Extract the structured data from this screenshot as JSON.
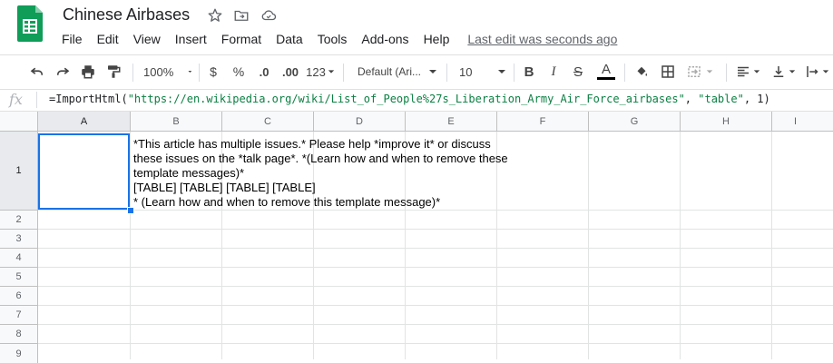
{
  "app": {
    "doc_title": "Chinese Airbases",
    "colors": {
      "logo_green": "#0f9d58",
      "selection_blue": "#1a73e8",
      "string_green": "#0b8043"
    }
  },
  "menu": {
    "items": [
      "File",
      "Edit",
      "View",
      "Insert",
      "Format",
      "Data",
      "Tools",
      "Add-ons",
      "Help"
    ],
    "last_edit": "Last edit was seconds ago"
  },
  "toolbar": {
    "zoom": "100%",
    "currency": "$",
    "percent": "%",
    "decrease_decimal": ".0",
    "increase_decimal": ".00",
    "more_formats": "123",
    "font": "Default (Ari...",
    "font_size": "10",
    "bold": "B",
    "italic": "I",
    "strikethrough": "S",
    "text_color": "A"
  },
  "formula_bar": {
    "fx": "fx",
    "func": "=ImportHtml(",
    "url": "\"https://en.wikipedia.org/wiki/List_of_People%27s_Liberation_Army_Air_Force_airbases\"",
    "comma1": ", ",
    "arg2": "\"table\"",
    "rest": ", 1)"
  },
  "grid": {
    "columns": [
      "A",
      "B",
      "C",
      "D",
      "E",
      "F",
      "G",
      "H",
      "I"
    ],
    "rows": [
      "1",
      "2",
      "3",
      "4",
      "5",
      "6",
      "7",
      "8",
      "9"
    ],
    "selected_cell": "A1",
    "b1_lines": [
      "*This article has multiple issues.* Please help *improve it* or discuss",
      "these issues on the *talk page*. *(Learn how and when to remove these",
      "template messages)*",
      "[TABLE] [TABLE] [TABLE] [TABLE]",
      "* (Learn how and when to remove this template message)*"
    ]
  }
}
